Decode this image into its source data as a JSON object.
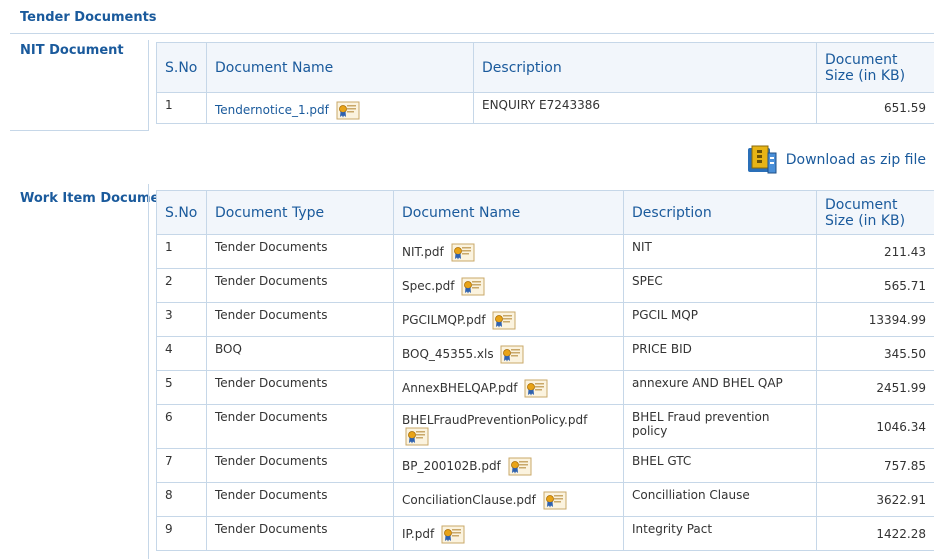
{
  "page_title": "Tender Documents",
  "nit_section": {
    "label": "NIT Document",
    "headers": {
      "sno": "S.No",
      "name": "Document Name",
      "description": "Description",
      "size": "Document Size (in KB)"
    },
    "rows": [
      {
        "sno": "1",
        "name": "Tendernotice_1.pdf",
        "description": "ENQUIRY E7243386",
        "size": "651.59"
      }
    ]
  },
  "download_zip": {
    "label": "Download as zip file",
    "icon": "zip-archive-icon"
  },
  "work_section": {
    "label": "Work Item Documents",
    "headers": {
      "sno": "S.No",
      "type": "Document Type",
      "name": "Document Name",
      "description": "Description",
      "size": "Document Size (in KB)"
    },
    "rows": [
      {
        "sno": "1",
        "type": "Tender Documents",
        "name": "NIT.pdf",
        "description": "NIT",
        "size": "211.43"
      },
      {
        "sno": "2",
        "type": "Tender Documents",
        "name": "Spec.pdf",
        "description": "SPEC",
        "size": "565.71"
      },
      {
        "sno": "3",
        "type": "Tender Documents",
        "name": "PGCILMQP.pdf",
        "description": "PGCIL MQP",
        "size": "13394.99"
      },
      {
        "sno": "4",
        "type": "BOQ",
        "name": "BOQ_45355.xls",
        "description": "PRICE BID",
        "size": "345.50"
      },
      {
        "sno": "5",
        "type": "Tender Documents",
        "name": "AnnexBHELQAP.pdf",
        "description": "annexure AND BHEL QAP",
        "size": "2451.99"
      },
      {
        "sno": "6",
        "type": "Tender Documents",
        "name": "BHELFraudPreventionPolicy.pdf",
        "description": "BHEL Fraud prevention policy",
        "size": "1046.34"
      },
      {
        "sno": "7",
        "type": "Tender Documents",
        "name": "BP_200102B.pdf",
        "description": "BHEL GTC",
        "size": "757.85"
      },
      {
        "sno": "8",
        "type": "Tender Documents",
        "name": "ConciliationClause.pdf",
        "description": "Concilliation Clause",
        "size": "3622.91"
      },
      {
        "sno": "9",
        "type": "Tender Documents",
        "name": "IP.pdf",
        "description": "Integrity Pact",
        "size": "1422.28"
      }
    ]
  },
  "colors": {
    "accent": "#1a5a9c",
    "border": "#c6d7e8",
    "header_bg": "#f2f6fb"
  }
}
